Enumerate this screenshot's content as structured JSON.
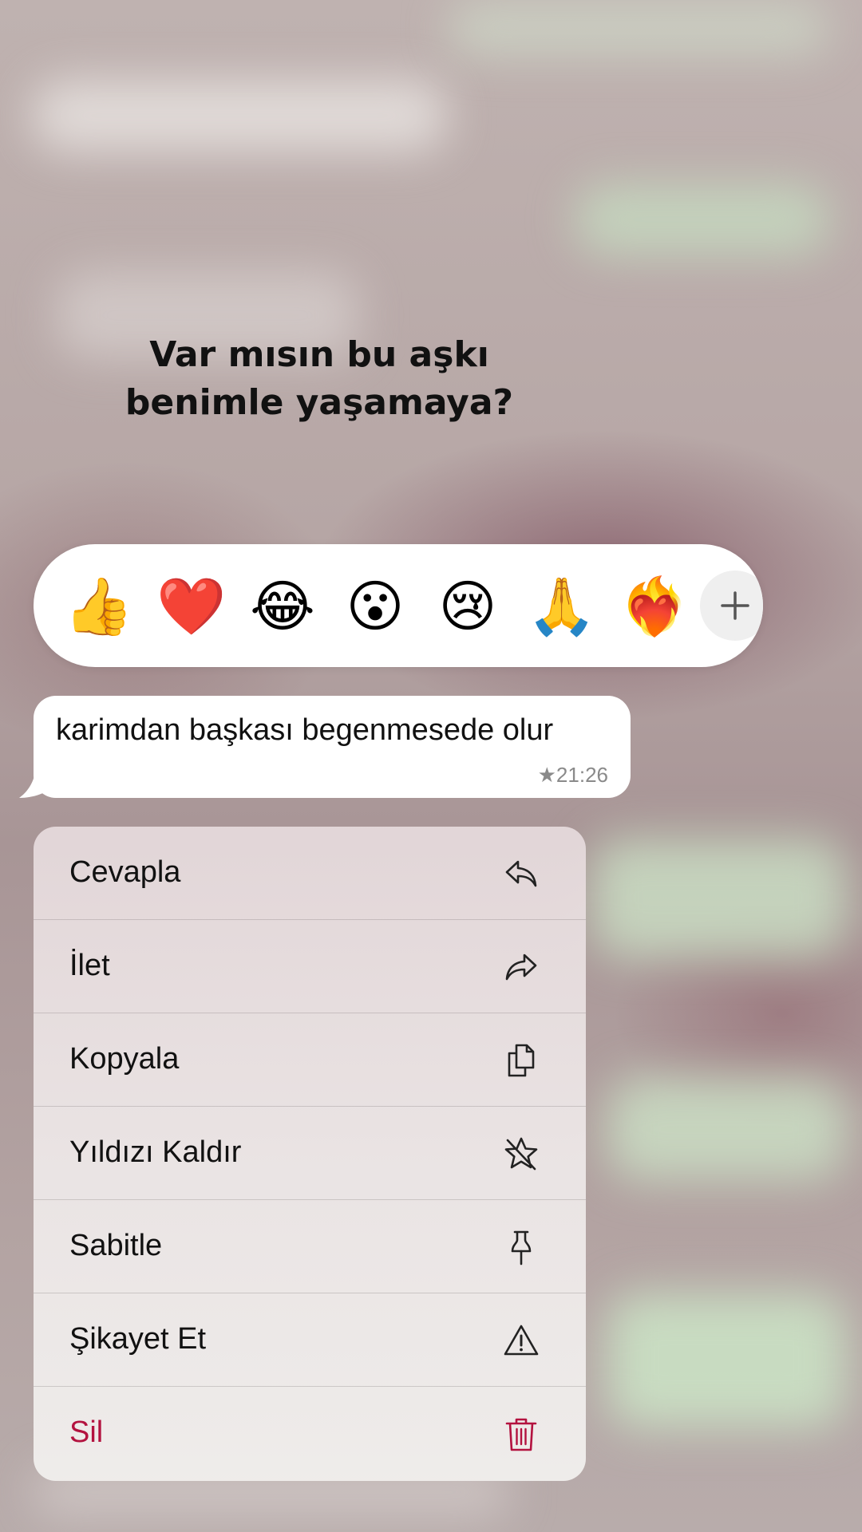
{
  "caption": {
    "line1": "Var mısın bu aşkı",
    "line2": "benimle yaşamaya?"
  },
  "reactions": [
    {
      "name": "thumbs-up",
      "glyph": "👍"
    },
    {
      "name": "red-heart",
      "glyph": "❤️"
    },
    {
      "name": "tears-of-joy",
      "glyph": "😂"
    },
    {
      "name": "surprised-face",
      "glyph": "😮"
    },
    {
      "name": "crying-face",
      "glyph": "😢"
    },
    {
      "name": "folded-hands",
      "glyph": "🙏"
    },
    {
      "name": "heart-on-fire",
      "glyph": "❤️‍🔥"
    }
  ],
  "more_reactions_icon": "plus-icon",
  "message": {
    "text": "karimdan başkası begenmesede olur",
    "meta": "★21:26"
  },
  "menu": {
    "items": [
      {
        "label": "Cevapla",
        "icon": "reply-icon"
      },
      {
        "label": "İlet",
        "icon": "forward-icon"
      },
      {
        "label": "Kopyala",
        "icon": "copy-icon"
      },
      {
        "label": "Yıldızı Kaldır",
        "icon": "unstar-icon"
      },
      {
        "label": "Sabitle",
        "icon": "pin-icon"
      },
      {
        "label": "Şikayet Et",
        "icon": "warning-icon"
      },
      {
        "label": "Sil",
        "icon": "trash-icon",
        "color": "#b3123f"
      }
    ]
  }
}
